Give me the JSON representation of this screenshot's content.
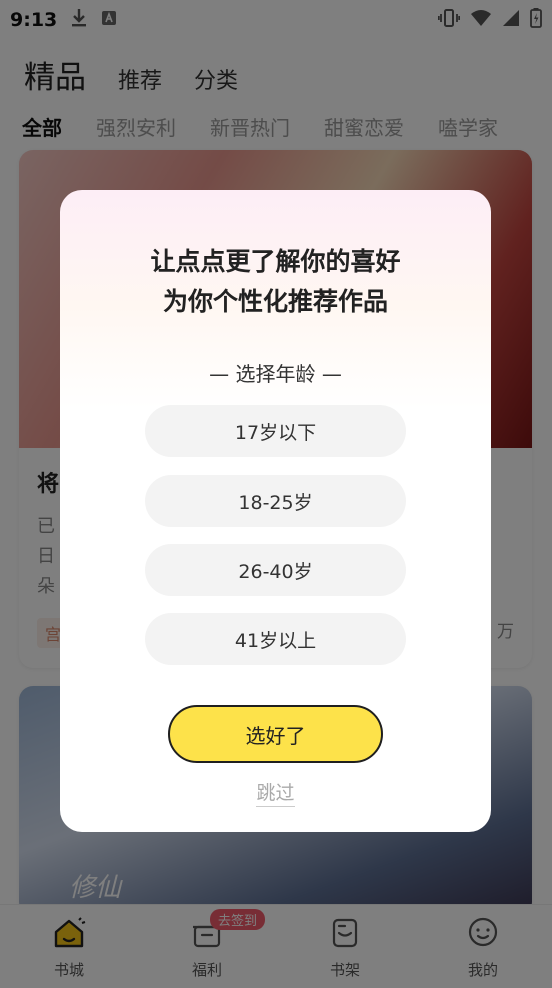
{
  "status_bar": {
    "time": "9:13"
  },
  "header": {
    "tabs": [
      {
        "label": "精品"
      },
      {
        "label": "推荐"
      },
      {
        "label": "分类"
      }
    ]
  },
  "categories": [
    {
      "label": "全部"
    },
    {
      "label": "强烈安利"
    },
    {
      "label": "新晋热门"
    },
    {
      "label": "甜蜜恋爱"
    },
    {
      "label": "嗑学家"
    }
  ],
  "feed": {
    "card1": {
      "title": "将",
      "desc_line1": "已",
      "desc_line2": "日",
      "desc_line3": "朵",
      "tag": "宫",
      "count": "万"
    },
    "card2": {
      "overlay_text": "修仙"
    }
  },
  "bottom_nav": {
    "items": [
      {
        "label": "书城"
      },
      {
        "label": "福利",
        "badge": "去签到"
      },
      {
        "label": "书架"
      },
      {
        "label": "我的"
      }
    ]
  },
  "modal": {
    "title_line1": "让点点更了解你的喜好",
    "title_line2": "为你个性化推荐作品",
    "subtitle": "— 选择年龄 —",
    "options": [
      {
        "label": "17岁以下"
      },
      {
        "label": "18-25岁"
      },
      {
        "label": "26-40岁"
      },
      {
        "label": "41岁以上"
      }
    ],
    "confirm_label": "选好了",
    "skip_label": "跳过"
  },
  "colors": {
    "accent_yellow": "#fde24a",
    "badge_pink": "#f05a6b",
    "nav_active": "#f5c518"
  }
}
